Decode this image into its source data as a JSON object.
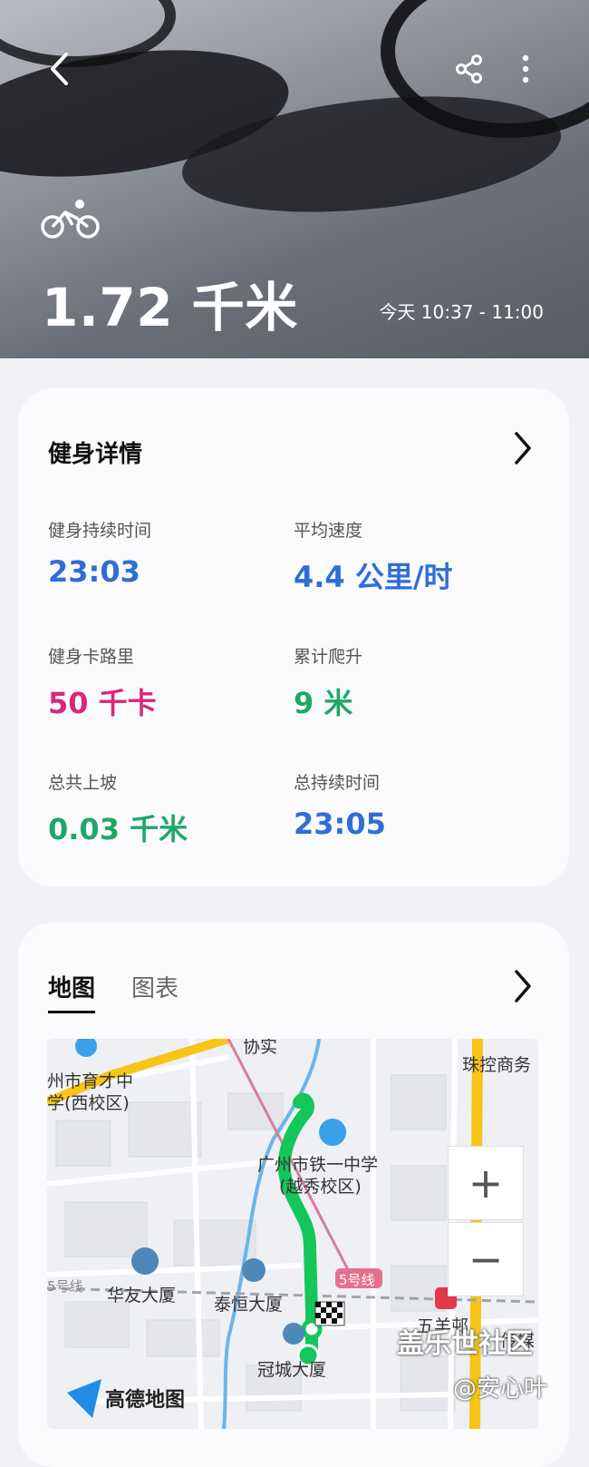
{
  "hero": {
    "distance": "1.72 千米",
    "time_range": "今天 10:37 - 11:00",
    "back_icon": "chevron-left-icon",
    "share_icon": "share-icon",
    "more_icon": "more-vertical-icon",
    "sport_icon": "bicycle-icon"
  },
  "details": {
    "title": "健身详情",
    "stats": [
      {
        "label": "健身持续时间",
        "value": "23:03"
      },
      {
        "label": "平均速度",
        "value": "4.4 公里/时"
      },
      {
        "label": "健身卡路里",
        "value": "50 千卡"
      },
      {
        "label": "累计爬升",
        "value": "9 米"
      },
      {
        "label": "总共上坡",
        "value": "0.03 千米"
      },
      {
        "label": "总持续时间",
        "value": "23:05"
      }
    ],
    "colors": {
      "blue": "#2f6ed6",
      "pink": "#d8287a",
      "green": "#1ea866"
    }
  },
  "map_card": {
    "tabs": [
      "地图",
      "图表"
    ],
    "active_tab": "地图",
    "map_labels": {
      "top": "协实",
      "school1_line1": "州市育才中",
      "school1_line2": "学(西校区)",
      "poi_right": "珠控商务",
      "school2_line1": "广州市铁一中学",
      "school2_line2": "(越秀校区)",
      "line5_left": "5号线",
      "building1": "华友大厦",
      "building2": "泰恒大厦",
      "line5_badge": "5号线",
      "station": "五羊邨",
      "station2": "传媒",
      "building3": "冠城大厦",
      "logo": "高德地图"
    },
    "zoom_in": "+",
    "zoom_out": "−"
  },
  "watermark": {
    "line1": "盖乐世社区",
    "line2": "@安心叶"
  }
}
